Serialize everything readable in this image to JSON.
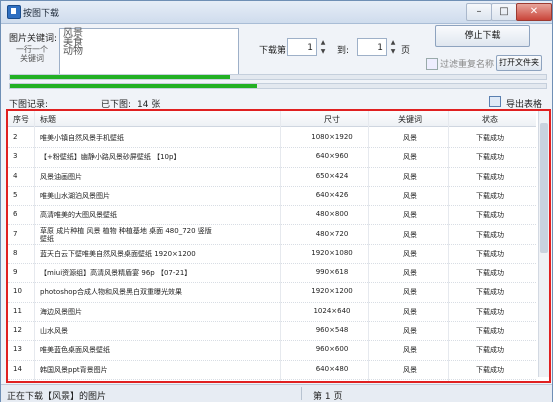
{
  "window": {
    "title": "按图下载",
    "minimize_label": "–",
    "maximize_label": "□",
    "close_label": "✕"
  },
  "keyword": {
    "label": "图片关键词:",
    "hint_line1": "一行一个",
    "hint_line2": "关键词",
    "values": [
      "风景",
      "美食",
      "动物"
    ]
  },
  "pages": {
    "from_label": "下载第:",
    "from_value": "1",
    "to_label": "到:",
    "to_value": "1",
    "unit": "页"
  },
  "actions": {
    "stop_label": "停止下载",
    "open_folder_label": "打开文件夹",
    "filter_dup_label": "过滤重复名称",
    "export_label": "导出表格"
  },
  "progress": {
    "top_fraction": 0.41,
    "bottom_fraction": 0.46
  },
  "records": {
    "label": "下图记录:",
    "downloaded_label": "已下图:",
    "downloaded_value": "14 张"
  },
  "table": {
    "headers": {
      "no": "序号",
      "title": "标题",
      "size": "尺寸",
      "keyword": "关键词",
      "status": "状态"
    },
    "rows": [
      {
        "no": "2",
        "title": "唯美小镇自然风景手机壁纸",
        "size": "1080×1920",
        "keyword": "风景",
        "status": "下载成功"
      },
      {
        "no": "3",
        "title": "【+粉壁纸】幽静小路风景砂屏壁纸 【10p】",
        "size": "640×960",
        "keyword": "风景",
        "status": "下载成功"
      },
      {
        "no": "4",
        "title": "风景油画图片",
        "size": "650×424",
        "keyword": "风景",
        "status": "下载成功"
      },
      {
        "no": "5",
        "title": "唯美山水湖泊风景图片",
        "size": "640×426",
        "keyword": "风景",
        "status": "下载成功"
      },
      {
        "no": "6",
        "title": "高清唯美的大图风景壁纸",
        "size": "480×800",
        "keyword": "风景",
        "status": "下载成功"
      },
      {
        "no": "7",
        "title": "草原 成片种植 风景 植物 种植基地 桌面 480_720 竖版",
        "title2": "壁纸",
        "size": "480×720",
        "keyword": "风景",
        "status": "下载成功"
      },
      {
        "no": "8",
        "title": "蓝天白云下壁唯美自然风景桌面壁纸 1920×1200",
        "size": "1920×1080",
        "keyword": "风景",
        "status": "下载成功"
      },
      {
        "no": "9",
        "title": "【miui资源组】高清风景精盾宴 96p 【07-21】",
        "size": "990×618",
        "keyword": "风景",
        "status": "下载成功"
      },
      {
        "no": "10",
        "title": "photoshop合成人物和风景黑白双重曝光效果",
        "size": "1920×1200",
        "keyword": "风景",
        "status": "下载成功"
      },
      {
        "no": "11",
        "title": "海边风景图片",
        "size": "1024×640",
        "keyword": "风景",
        "status": "下载成功"
      },
      {
        "no": "12",
        "title": "山水风景",
        "size": "960×548",
        "keyword": "风景",
        "status": "下载成功"
      },
      {
        "no": "13",
        "title": "唯美蓝色桌面风景壁纸",
        "size": "960×600",
        "keyword": "风景",
        "status": "下载成功"
      },
      {
        "no": "14",
        "title": "韩国风景ppt背景图片",
        "size": "640×480",
        "keyword": "风景",
        "status": "下载成功"
      }
    ]
  },
  "status": {
    "left": "正在下载【风景】的图片",
    "page": "第 1 页"
  },
  "colors": {
    "progress": "#22b024",
    "highlight_border": "#e02020"
  }
}
